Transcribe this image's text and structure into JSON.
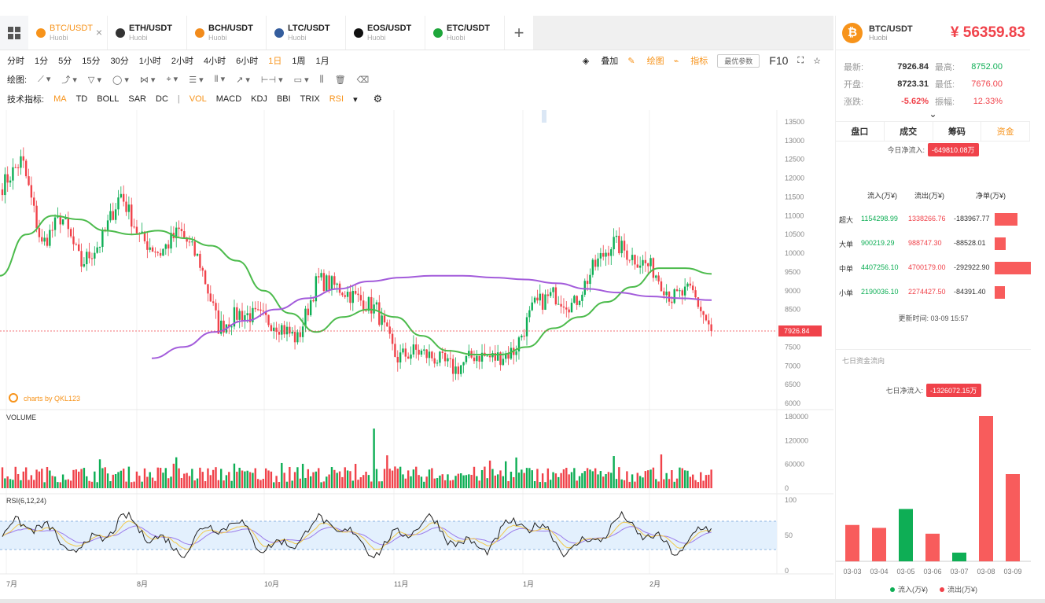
{
  "tabs": [
    {
      "pair": "BTC/USDT",
      "sub": "Huobi",
      "color": "#f7931a",
      "active": true
    },
    {
      "pair": "ETH/USDT",
      "sub": "Huobi",
      "color": "#333333",
      "active": false
    },
    {
      "pair": "BCH/USDT",
      "sub": "Huobi",
      "color": "#f28b1b",
      "active": false
    },
    {
      "pair": "LTC/USDT",
      "sub": "Huobi",
      "color": "#345d9d",
      "active": false
    },
    {
      "pair": "EOS/USDT",
      "sub": "Huobi",
      "color": "#111111",
      "active": false
    },
    {
      "pair": "ETC/USDT",
      "sub": "Huobi",
      "color": "#1ea63a",
      "active": false
    }
  ],
  "intervals": [
    "分时",
    "1分",
    "5分",
    "15分",
    "30分",
    "1小时",
    "2小时",
    "4小时",
    "6小时",
    "1日",
    "1周",
    "1月"
  ],
  "active_interval": "1日",
  "right_tools": {
    "overlay": "叠加",
    "draw": "绘图",
    "indicator": "指标",
    "params": "最优参数",
    "f10": "F10"
  },
  "draw_label": "绘图:",
  "indicators_label": "技术指标:",
  "indicators": [
    "MA",
    "TD",
    "BOLL",
    "SAR",
    "DC",
    "|",
    "VOL",
    "MACD",
    "KDJ",
    "BBI",
    "TRIX",
    "RSI"
  ],
  "active_indicators": [
    "MA",
    "VOL",
    "RSI"
  ],
  "panel": {
    "pair": "BTC/USDT",
    "exchange": "Huobi",
    "price": "¥ 56359.83",
    "stats": [
      {
        "k": "最新:",
        "v": "7926.84",
        "k2": "最高:",
        "v2": "8752.00",
        "c2": "green"
      },
      {
        "k": "开盘:",
        "v": "8723.31",
        "k2": "最低:",
        "v2": "7676.00",
        "c2": "red"
      },
      {
        "k": "涨跌:",
        "v": "-5.62%",
        "k2": "振幅:",
        "v2": "12.33%",
        "c1": "red",
        "c2": "red"
      }
    ],
    "tabs": [
      "盘口",
      "成交",
      "筹码",
      "资金"
    ],
    "active_tab": "资金",
    "today_label": "今日净流入:",
    "today_value": "-649810.08万",
    "flow_headers": [
      "流入(万¥)",
      "流出(万¥)",
      "净单(万¥)"
    ],
    "flows": [
      {
        "name": "超大",
        "in": "1154298.99",
        "out": "1338266.76",
        "net": "-183967.77",
        "netv": 183967.77
      },
      {
        "name": "大单",
        "in": "900219.29",
        "out": "988747.30",
        "net": "-88528.01",
        "netv": 88528.01
      },
      {
        "name": "中单",
        "in": "4407256.10",
        "out": "4700179.00",
        "net": "-292922.90",
        "netv": 292922.9
      },
      {
        "name": "小单",
        "in": "2190036.10",
        "out": "2274427.50",
        "net": "-84391.40",
        "netv": 84391.4
      }
    ],
    "update_time": "更新时间: 03-09 15:57",
    "seven_title": "七日资金流向",
    "seven_label": "七日净流入:",
    "seven_value": "-1326072.15万",
    "legend_in": "流入(万¥)",
    "legend_out": "流出(万¥)"
  },
  "colors": {
    "up": "#0eae55",
    "down": "#f0424a",
    "ma_short": "#4cbb4c",
    "ma_long": "#a35cdb",
    "accent": "#f7931a"
  },
  "watermark": "charts by QKL123",
  "chart_data": [
    {
      "type": "candlestick",
      "title": "",
      "y_ticks": [
        13500,
        13000,
        12500,
        12000,
        11500,
        11000,
        10500,
        10000,
        9500,
        9000,
        8500,
        8000,
        7500,
        7000,
        6500,
        6000
      ],
      "ylim": [
        6000,
        13500
      ],
      "x_labels": [
        "7月",
        "8月",
        "10月",
        "11月",
        "1月",
        "2月"
      ],
      "last_price": "7926.84",
      "close_path": [
        [
          "7月",
          11800
        ],
        [
          null,
          12500
        ],
        [
          null,
          10200
        ],
        [
          null,
          11000
        ],
        [
          null,
          9700
        ],
        [
          null,
          10300
        ],
        [
          "8月",
          11600
        ],
        [
          null,
          10400
        ],
        [
          null,
          10000
        ],
        [
          null,
          10600
        ],
        [
          null,
          9800
        ],
        [
          null,
          8000
        ],
        [
          null,
          8400
        ],
        [
          null,
          8300
        ],
        [
          "10月",
          8100
        ],
        [
          null,
          7700
        ],
        [
          null,
          9300
        ],
        [
          null,
          9100
        ],
        [
          null,
          8800
        ],
        [
          "11月",
          8500
        ],
        [
          null,
          7200
        ],
        [
          null,
          7400
        ],
        [
          null,
          7200
        ],
        [
          null,
          6900
        ],
        [
          null,
          7300
        ],
        [
          null,
          7200
        ],
        [
          "1月",
          7400
        ],
        [
          null,
          8600
        ],
        [
          null,
          8900
        ],
        [
          null,
          8600
        ],
        [
          null,
          9600
        ],
        [
          null,
          10300
        ],
        [
          "2月",
          9900
        ],
        [
          null,
          9600
        ],
        [
          null,
          8800
        ],
        [
          null,
          9000
        ],
        [
          null,
          7926.84
        ]
      ],
      "ma_short": [
        9400,
        10500,
        11000,
        10900,
        10600,
        10500,
        10600,
        10400,
        10200,
        9800,
        9000,
        8400,
        7900,
        8300,
        8500,
        8300,
        7800,
        7400,
        7300,
        7300,
        7500,
        8000,
        8300,
        8700,
        9100,
        9600,
        9600,
        9450
      ],
      "ma_long": [
        7200,
        7500,
        7900,
        8200,
        8500,
        8800,
        9050,
        9250,
        9350,
        9400,
        9400,
        9350,
        9300,
        9200,
        9050,
        8950,
        8850,
        8800,
        8750
      ]
    },
    {
      "type": "bar",
      "title": "VOLUME",
      "y_ticks": [
        180000,
        120000,
        60000,
        0
      ],
      "ylim": [
        0,
        180000
      ]
    },
    {
      "type": "line",
      "title": "RSI(6,12,24)",
      "y_ticks": [
        100,
        50,
        0
      ],
      "ylim": [
        0,
        100
      ],
      "band": [
        30,
        70
      ]
    },
    {
      "type": "bar",
      "title": "七日资金流向",
      "categories": [
        "03-03",
        "03-04",
        "03-05",
        "03-06",
        "03-07",
        "03-08",
        "03-09"
      ],
      "values": [
        -0.25,
        -0.23,
        0.36,
        -0.19,
        0.06,
        -1.0,
        -0.6
      ],
      "units": "relative"
    }
  ]
}
